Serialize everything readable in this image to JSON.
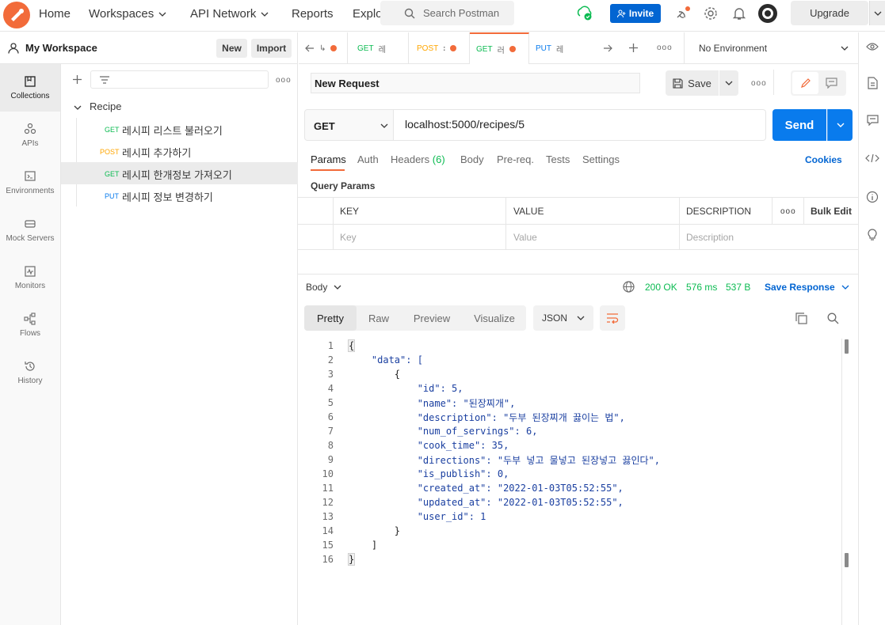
{
  "topbar": {
    "nav": [
      "Home",
      "Workspaces",
      "API Network",
      "Reports",
      "Explo"
    ],
    "search_placeholder": "Search Postman",
    "invite_label": "Invite",
    "upgrade_label": "Upgrade"
  },
  "workspace": {
    "title": "My Workspace",
    "new_label": "New",
    "import_label": "Import"
  },
  "rail": [
    {
      "label": "Collections",
      "icon": "collections-icon"
    },
    {
      "label": "APIs",
      "icon": "apis-icon"
    },
    {
      "label": "Environments",
      "icon": "environments-icon"
    },
    {
      "label": "Mock Servers",
      "icon": "mock-servers-icon"
    },
    {
      "label": "Monitors",
      "icon": "monitors-icon"
    },
    {
      "label": "Flows",
      "icon": "flows-icon"
    },
    {
      "label": "History",
      "icon": "history-icon"
    }
  ],
  "tree": {
    "collection": "Recipe",
    "requests": [
      {
        "method": "GET",
        "name": "레시피 리스트 불러오기"
      },
      {
        "method": "POST",
        "name": "레시피 추가하기"
      },
      {
        "method": "GET",
        "name": "레시피 한개정보 가져오기"
      },
      {
        "method": "PUT",
        "name": "레시피 정보 변경하기"
      }
    ]
  },
  "tabs": [
    {
      "method": "",
      "name": "↳"
    },
    {
      "method": "GET",
      "name": "레"
    },
    {
      "method": "POST",
      "name": "ꓽ"
    },
    {
      "method": "GET",
      "name": "러"
    },
    {
      "method": "PUT",
      "name": "레"
    }
  ],
  "environment": "No Environment",
  "request": {
    "name": "New Request",
    "save_label": "Save",
    "method": "GET",
    "url": "localhost:5000/recipes/5",
    "send_label": "Send",
    "tabs": [
      "Params",
      "Auth",
      "Headers",
      "(6)",
      "Body",
      "Pre-req.",
      "Tests",
      "Settings"
    ],
    "cookies_label": "Cookies",
    "query_params_label": "Query Params",
    "table": {
      "headers": [
        "KEY",
        "VALUE",
        "DESCRIPTION"
      ],
      "bulk_edit": "Bulk Edit",
      "placeholders": [
        "Key",
        "Value",
        "Description"
      ]
    }
  },
  "response": {
    "body_label": "Body",
    "status": "200 OK",
    "time": "576 ms",
    "size": "537 B",
    "save_response": "Save Response",
    "views": [
      "Pretty",
      "Raw",
      "Preview",
      "Visualize"
    ],
    "format": "JSON",
    "line_numbers": [
      "1",
      "2",
      "3",
      "4",
      "5",
      "6",
      "7",
      "8",
      "9",
      "10",
      "11",
      "12",
      "13",
      "14",
      "15",
      "16"
    ],
    "lines": [
      "{",
      "    \"data\": [",
      "        {",
      "            \"id\": 5,",
      "            \"name\": \"된장찌개\",",
      "            \"description\": \"두부 된장찌개 끓이는 법\",",
      "            \"num_of_servings\": 6,",
      "            \"cook_time\": 35,",
      "            \"directions\": \"두부 넣고 물넣고 된장넣고 끓인다\",",
      "            \"is_publish\": 0,",
      "            \"created_at\": \"2022-01-03T05:52:55\",",
      "            \"updated_at\": \"2022-01-03T05:52:55\",",
      "            \"user_id\": 1",
      "        }",
      "    ]",
      "}"
    ]
  },
  "colors": {
    "accent": "#f26b3a",
    "send": "#097bed",
    "get": "#0cbb52",
    "post": "#ffa600",
    "put": "#097bed",
    "status_ok": "#0cbb52"
  }
}
